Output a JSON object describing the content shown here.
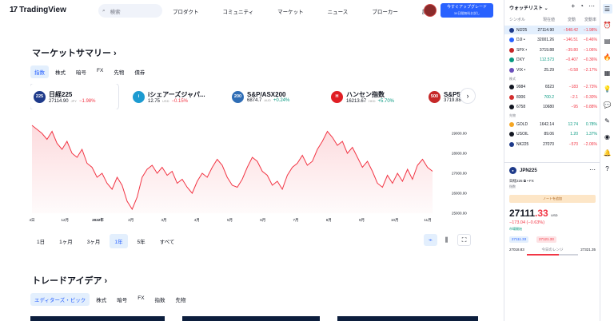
{
  "header": {
    "logo_text": "TradingView",
    "search_placeholder": "検索",
    "nav": [
      "プロダクト",
      "コミュニティ",
      "マーケット",
      "ニュース",
      "ブローカー",
      "詳細"
    ],
    "upgrade_label": "今すぐアップグレード",
    "upgrade_sub": "30日間無料お試し"
  },
  "market_summary": {
    "title": "マーケットサマリー ›",
    "tabs": [
      "指数",
      "株式",
      "暗号",
      "FX",
      "先物",
      "債券"
    ],
    "active_tab": "指数",
    "cards": [
      {
        "badge": "225",
        "color": "#1e3a8a",
        "name": "日経225",
        "price": "27114.90",
        "currency": "JPY",
        "change": "−1.98%",
        "dir": "neg"
      },
      {
        "badge": "i",
        "color": "#1d9bd1",
        "name": "iシェアーズジャパ...",
        "price": "12.75",
        "currency": "USD",
        "change": "−0.15%",
        "dir": "neg"
      },
      {
        "badge": "200",
        "color": "#2f6db5",
        "name": "S&P/ASX200",
        "price": "6874.7",
        "currency": "AUD",
        "change": "+0.24%",
        "dir": "pos"
      },
      {
        "badge": "H",
        "color": "#e01e24",
        "name": "ハンセン指数",
        "price": "16213.67",
        "currency": "HKD",
        "change": "+5.70%",
        "dir": "pos"
      },
      {
        "badge": "500",
        "color": "#c62828",
        "name": "S&P500",
        "price": "3719.88",
        "currency": "USD",
        "change": "",
        "dir": "neg"
      }
    ],
    "ranges": [
      "1日",
      "1ヶ月",
      "3ヶ月",
      "1年",
      "5年",
      "すべて"
    ],
    "active_range": "1年"
  },
  "chart_data": {
    "type": "area",
    "x_ticks": [
      "4日",
      "12月",
      "2022年",
      "2月",
      "3月",
      "4月",
      "5月",
      "6月",
      "7月",
      "8月",
      "9月",
      "10月",
      "11月"
    ],
    "y_ticks": [
      29000,
      28000,
      27000,
      26000,
      25000
    ],
    "ylim": [
      25000,
      29600
    ],
    "values": [
      29400,
      29200,
      29000,
      28700,
      29100,
      28500,
      28200,
      28600,
      28000,
      27800,
      28200,
      27500,
      27300,
      26800,
      27000,
      26500,
      26200,
      26800,
      26400,
      25600,
      25200,
      25800,
      26800,
      27200,
      27400,
      27000,
      27300,
      26900,
      27100,
      26500,
      26700,
      26300,
      26000,
      26600,
      27000,
      26800,
      27300,
      27700,
      27400,
      26800,
      26400,
      26300,
      26700,
      27300,
      27800,
      27600,
      27100,
      26900,
      26400,
      26600,
      26200,
      26900,
      27300,
      27500,
      27900,
      27400,
      27600,
      28200,
      28600,
      29100,
      28800,
      28400,
      28600,
      28000,
      28300,
      27800,
      27300,
      27600,
      27100,
      26500,
      26300,
      26900,
      26500,
      27000,
      26600,
      27200,
      26700,
      27400,
      27700,
      27300,
      27100
    ],
    "line_color": "#f23645"
  },
  "trade_ideas": {
    "title": "トレードアイデア ›",
    "tabs": [
      "エディターズ・ピック",
      "株式",
      "暗号",
      "FX",
      "指数",
      "先物"
    ],
    "active_tab": "エディターズ・ピック"
  },
  "watchlist": {
    "title": "ウォッチリスト ⌄",
    "columns": [
      "シンボル",
      "現在値",
      "変動",
      "変動率"
    ],
    "rows": [
      {
        "sym": "NI225",
        "last": "27114.90",
        "chg": "−548.42",
        "pct": "−1.98%",
        "color": "#1e3a8a",
        "dir": "neg",
        "sel": true
      },
      {
        "sym": "DJI •",
        "last": "32001.26",
        "chg": "−146.51",
        "pct": "−0.46%",
        "color": "#2962ff",
        "dir": "neg"
      },
      {
        "sym": "SPX •",
        "last": "3719.88",
        "chg": "−39.80",
        "pct": "−1.06%",
        "color": "#c62828",
        "dir": "neg"
      },
      {
        "sym": "DXY",
        "last": "112.573",
        "chg": "−0.407",
        "pct": "−0.36%",
        "color": "#089981",
        "dir": "neg",
        "lastpos": true
      },
      {
        "sym": "VIX •",
        "last": "25.29",
        "chg": "−0.58",
        "pct": "−2.17%",
        "color": "#6b4fbb",
        "dir": "neg"
      },
      {
        "group": "株式"
      },
      {
        "sym": "9984",
        "last": "6523",
        "chg": "−183",
        "pct": "−2.73%",
        "color": "#131722",
        "dir": "neg"
      },
      {
        "sym": "8306",
        "last": "700.2",
        "chg": "−2.1",
        "pct": "−0.30%",
        "color": "#d32f2f",
        "dir": "neg",
        "lastpos": true
      },
      {
        "sym": "6758",
        "last": "10680",
        "chg": "−95",
        "pct": "−0.88%",
        "color": "#131722",
        "dir": "neg"
      },
      {
        "group": "先物"
      },
      {
        "sym": "GOLD",
        "last": "1642.14",
        "chg": "12.74",
        "pct": "0.78%",
        "color": "#f5a623",
        "dir": "pos"
      },
      {
        "sym": "USOIL",
        "last": "89.06",
        "chg": "1.20",
        "pct": "1.37%",
        "color": "#131722",
        "dir": "pos"
      },
      {
        "sym": "NK225",
        "last": "27070",
        "chg": "−570",
        "pct": "−2.06%",
        "color": "#1e3a8a",
        "dir": "neg"
      }
    ]
  },
  "detail": {
    "symbol": "JPN225",
    "desc": "日経225 ⧉ • FX",
    "category": "指数",
    "note_label": "ノートを追加",
    "price_main": "27111",
    "price_small": ".33",
    "currency": "USD",
    "change": "−173.04 (−0.63%)",
    "status": "市場開始",
    "bid": "27111.33",
    "ask": "27121.33",
    "low": "27018.83",
    "range_label": "今日のレンジ",
    "high": "27321.35",
    "day_range_fill": 0.62
  }
}
